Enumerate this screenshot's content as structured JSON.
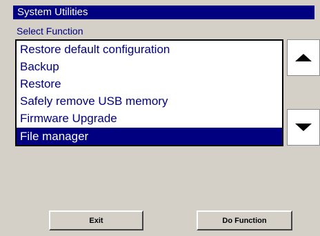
{
  "window": {
    "title": "System Utilities"
  },
  "section_label": "Select Function",
  "functions": [
    {
      "label": "Restore default configuration",
      "selected": false
    },
    {
      "label": "Backup",
      "selected": false
    },
    {
      "label": "Restore",
      "selected": false
    },
    {
      "label": "Safely remove USB memory",
      "selected": false
    },
    {
      "label": "Firmware Upgrade",
      "selected": false
    },
    {
      "label": "File manager",
      "selected": true
    }
  ],
  "scroll": {
    "up_icon": "triangle-up-icon",
    "down_icon": "triangle-down-icon"
  },
  "buttons": {
    "exit": "Exit",
    "do_function": "Do Function"
  },
  "colors": {
    "title_bar": "#000080",
    "selection": "#000080",
    "panel": "#d4d0c8",
    "text": "#000080"
  }
}
